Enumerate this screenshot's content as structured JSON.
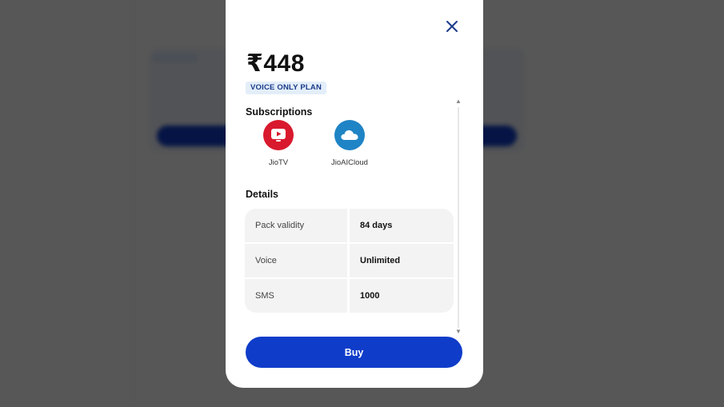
{
  "modal": {
    "price": "₹448",
    "plan_tag": "VOICE ONLY PLAN",
    "close_icon": "close-icon",
    "subscriptions_title": "Subscriptions",
    "subscriptions": [
      {
        "label": "JioTV",
        "icon": "jiotv-icon",
        "color": "#d9192d"
      },
      {
        "label": "JioAICloud",
        "icon": "jioaicloud-icon",
        "color": "#1f84c5"
      }
    ],
    "details_title": "Details",
    "details": [
      {
        "key": "Pack validity",
        "value": "84 days"
      },
      {
        "key": "Voice",
        "value": "Unlimited"
      },
      {
        "key": "SMS",
        "value": "1000"
      }
    ],
    "buy_label": "Buy"
  },
  "colors": {
    "accent": "#0f3cc9",
    "tag_bg": "#e3eef9",
    "overlay": "#000000"
  }
}
